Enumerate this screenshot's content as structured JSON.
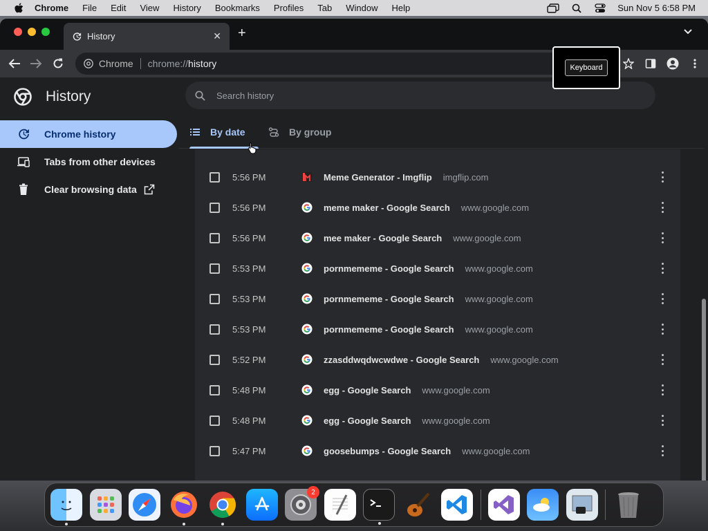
{
  "menubar": {
    "app_name": "Chrome",
    "items": [
      "File",
      "Edit",
      "View",
      "History",
      "Bookmarks",
      "Profiles",
      "Tab",
      "Window",
      "Help"
    ],
    "clock": "Sun Nov 5  6:58 PM"
  },
  "browser": {
    "tab_title": "History",
    "omnibox_scheme": "Chrome",
    "omnibox_url_prefix": "chrome://",
    "omnibox_url_path": "history",
    "tooltip": "Keyboard"
  },
  "history": {
    "page_title": "History",
    "search_placeholder": "Search history",
    "sidebar": [
      {
        "label": "Chrome history"
      },
      {
        "label": "Tabs from other devices"
      },
      {
        "label": "Clear browsing data"
      }
    ],
    "tabs": {
      "by_date": "By date",
      "by_group": "By group"
    },
    "entries": [
      {
        "time": "5:56 PM",
        "title": "Meme Generator - Imgflip",
        "domain": "imgflip.com",
        "favicon": "imgflip-icon"
      },
      {
        "time": "5:56 PM",
        "title": "meme maker - Google Search",
        "domain": "www.google.com",
        "favicon": "google-icon"
      },
      {
        "time": "5:56 PM",
        "title": "mee maker - Google Search",
        "domain": "www.google.com",
        "favicon": "google-icon"
      },
      {
        "time": "5:53 PM",
        "title": "pornmememe - Google Search",
        "domain": "www.google.com",
        "favicon": "google-icon"
      },
      {
        "time": "5:53 PM",
        "title": "pornmememe - Google Search",
        "domain": "www.google.com",
        "favicon": "google-icon"
      },
      {
        "time": "5:53 PM",
        "title": "pornmememe - Google Search",
        "domain": "www.google.com",
        "favicon": "google-icon"
      },
      {
        "time": "5:52 PM",
        "title": "zzasddwqdwcwdwe - Google Search",
        "domain": "www.google.com",
        "favicon": "google-icon"
      },
      {
        "time": "5:48 PM",
        "title": "egg - Google Search",
        "domain": "www.google.com",
        "favicon": "google-icon"
      },
      {
        "time": "5:48 PM",
        "title": "egg - Google Search",
        "domain": "www.google.com",
        "favicon": "google-icon"
      },
      {
        "time": "5:47 PM",
        "title": "goosebumps - Google Search",
        "domain": "www.google.com",
        "favicon": "google-icon"
      }
    ]
  },
  "dock": {
    "apps": [
      "finder-icon",
      "launchpad-icon",
      "safari-icon",
      "firefox-icon",
      "chrome-icon",
      "app-store-icon",
      "system-settings-icon",
      "textedit-icon",
      "terminal-icon",
      "garageband-icon",
      "vscode-icon",
      "visual-studio-icon",
      "weather-icon",
      "preview-icon",
      "trash-icon"
    ],
    "settings_badge": "2"
  },
  "colors": {
    "accent": "#a8c7fa",
    "background": "#1f2022",
    "list_bg": "#28292c"
  }
}
